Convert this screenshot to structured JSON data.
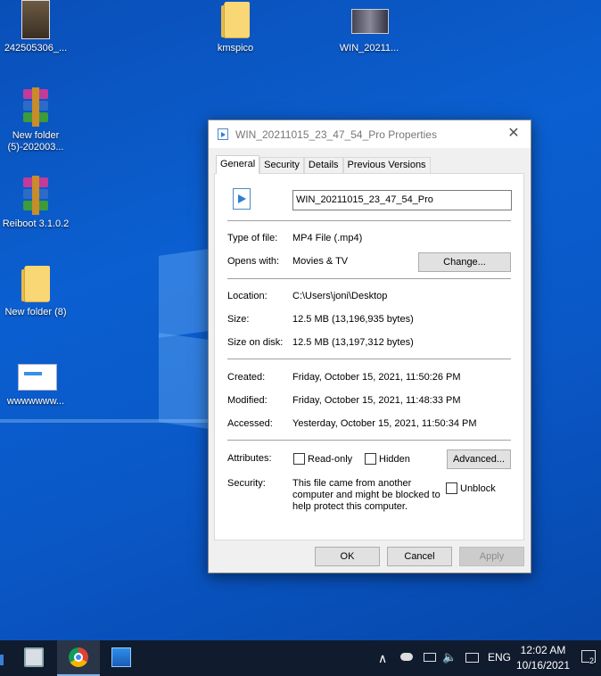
{
  "desktop": {
    "icons": [
      {
        "label": "242505306_..."
      },
      {
        "label": "kmspico"
      },
      {
        "label": "WIN_20211..."
      },
      {
        "label": "New folder (5)-202003..."
      },
      {
        "label": "Reiboot 3.1.0.2"
      },
      {
        "label": "New folder (8)"
      },
      {
        "label": "wwwwwww..."
      }
    ]
  },
  "dialog": {
    "title": "WIN_20211015_23_47_54_Pro Properties",
    "close_glyph": "✕",
    "tabs": [
      "General",
      "Security",
      "Details",
      "Previous Versions"
    ],
    "file_name": "WIN_20211015_23_47_54_Pro",
    "type_label": "Type of file:",
    "type_value": "MP4 File (.mp4)",
    "opens_label": "Opens with:",
    "opens_value": "Movies & TV",
    "change_button": "Change...",
    "location_label": "Location:",
    "location_value": "C:\\Users\\joni\\Desktop",
    "size_label": "Size:",
    "size_value": "12.5 MB (13,196,935 bytes)",
    "size_disk_label": "Size on disk:",
    "size_disk_value": "12.5 MB (13,197,312 bytes)",
    "created_label": "Created:",
    "created_value": "Friday, October 15, 2021, 11:50:26 PM",
    "modified_label": "Modified:",
    "modified_value": "Friday, October 15, 2021, 11:48:33 PM",
    "accessed_label": "Accessed:",
    "accessed_value": "Yesterday, October 15, 2021, 11:50:34 PM",
    "attributes_label": "Attributes:",
    "readonly_label": "Read-only",
    "hidden_label": "Hidden",
    "advanced_button": "Advanced...",
    "security_label": "Security:",
    "security_text_1": "This file came from another",
    "security_text_2": "computer and might be blocked to",
    "security_text_3": "help protect this computer.",
    "unblock_label": "Unblock",
    "ok_button": "OK",
    "cancel_button": "Cancel",
    "apply_button": "Apply"
  },
  "taskbar": {
    "language": "ENG",
    "time": "12:02 AM",
    "date": "10/16/2021",
    "notification_count": "2"
  }
}
